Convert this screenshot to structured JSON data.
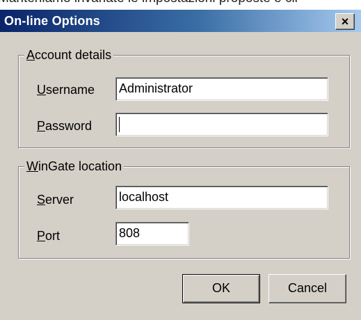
{
  "background": {
    "partial_text": "Manteniamo invariate le impostazioni proposte e cli"
  },
  "dialog": {
    "title": "On-line Options",
    "close_glyph": "×"
  },
  "account": {
    "legend_mnemonic": "A",
    "legend_rest": "ccount details",
    "username_mnemonic": "U",
    "username_rest": "sername",
    "username_value": "Administrator",
    "password_mnemonic": "P",
    "password_rest": "assword",
    "password_value": ""
  },
  "location": {
    "legend_mnemonic": "W",
    "legend_rest": "inGate location",
    "server_mnemonic": "S",
    "server_rest": "erver",
    "server_value": "localhost",
    "port_mnemonic": "P",
    "port_rest": "ort",
    "port_value": "808"
  },
  "buttons": {
    "ok": "OK",
    "cancel": "Cancel"
  }
}
